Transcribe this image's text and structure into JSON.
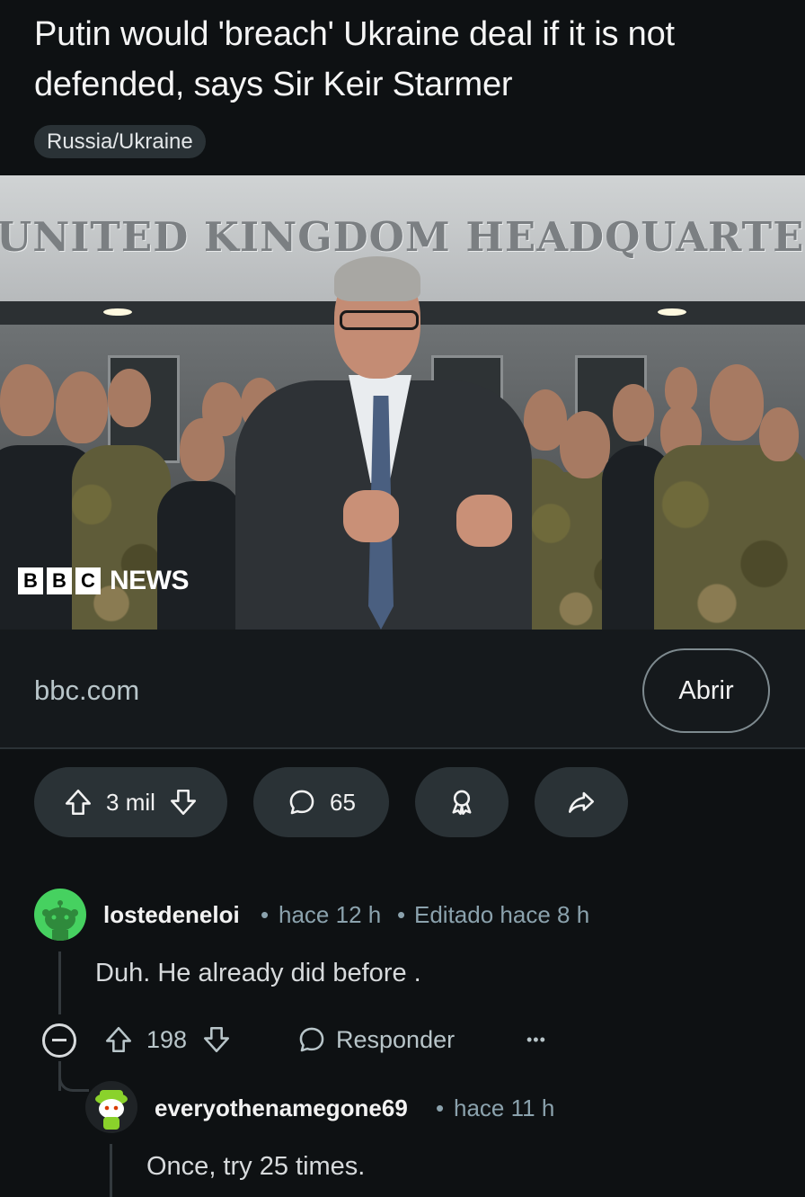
{
  "post": {
    "title": "Putin would 'breach' Ukraine deal if it is not defended, says Sir Keir Starmer",
    "flair": "Russia/Ukraine"
  },
  "link_image": {
    "sign_text": "UNITED KINGDOM HEADQUARTERS",
    "logo": {
      "blocks": [
        "B",
        "B",
        "C"
      ],
      "news": "NEWS"
    }
  },
  "link": {
    "domain": "bbc.com",
    "open_label": "Abrir"
  },
  "actions": {
    "votes": "3 mil",
    "comments": "65"
  },
  "comments": [
    {
      "author": "lostedeneloi",
      "time": "hace 12 h",
      "edited": "Editado hace 8 h",
      "body": "Duh. He already did before .",
      "votes": "198",
      "reply_label": "Responder",
      "more": "•••"
    },
    {
      "author": "everyothenamegone69",
      "time": "hace 11 h",
      "body": "Once, try 25 times."
    }
  ],
  "colors": {
    "background": "#0e1113",
    "pill": "#2a3236",
    "meta_text": "#8ba2ad",
    "avatar_green": "#46d160"
  }
}
